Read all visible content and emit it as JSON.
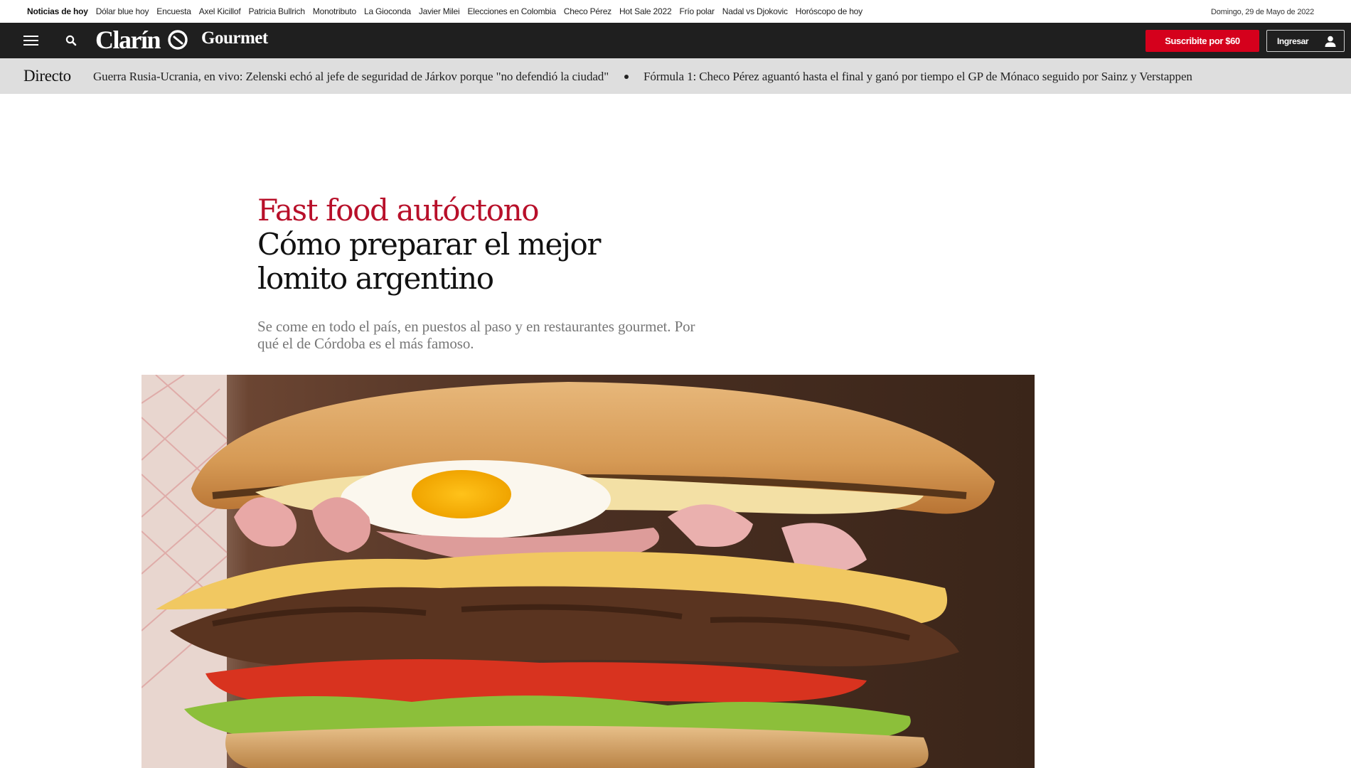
{
  "trending": {
    "links": [
      "Noticias de hoy",
      "Dólar blue hoy",
      "Encuesta",
      "Axel Kicillof",
      "Patricia Bullrich",
      "Monotributo",
      "La Gioconda",
      "Javier Milei",
      "Elecciones en Colombia",
      "Checo Pérez",
      "Hot Sale 2022",
      "Frío polar",
      "Nadal vs Djokovic",
      "Horóscopo de hoy"
    ],
    "date": "Domingo, 29 de Mayo de 2022"
  },
  "nav": {
    "menu_icon": "hamburger-menu-icon",
    "search_icon": "search-icon",
    "logo": "Clarín",
    "section": "Gourmet",
    "subscribe_label": "Suscribite por $60",
    "login_label": "Ingresar",
    "user_icon": "user-icon"
  },
  "ticker": {
    "label": "Directo",
    "items": [
      "Guerra Rusia-Ucrania, en vivo: Zelenski echó al jefe de seguridad de Járkov porque \"no defendió la ciudad\"",
      "Fórmula 1: Checo Pérez aguantó hasta el final y ganó por tiempo el GP de Mónaco seguido por Sainz y Verstappen"
    ]
  },
  "article": {
    "kicker": "Fast food autóctono",
    "headline": "Cómo preparar el mejor lomito argentino",
    "lead": "Se come en todo el país, en puestos al paso y en restaurantes gourmet. Por qué el de Córdoba es el más famoso."
  },
  "colors": {
    "brand_red": "#d5001c",
    "kicker_red": "#b8102a",
    "nav_bg": "#1f1f1f",
    "ticker_bg": "#dedede"
  }
}
